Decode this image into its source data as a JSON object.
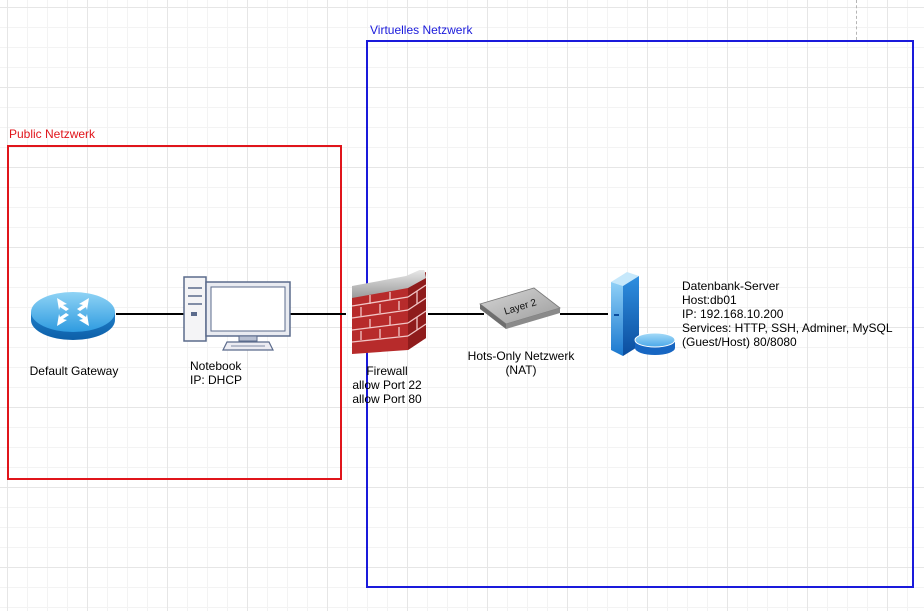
{
  "zones": {
    "public": {
      "label": "Public Netzwerk",
      "color": "#e0151b"
    },
    "virtual": {
      "label": "Virtuelles Netzwerk",
      "color": "#1a1adb"
    }
  },
  "nodes": {
    "gateway": {
      "icon": "router-icon",
      "label": "Default Gateway"
    },
    "notebook": {
      "icon": "desktop-computer-icon",
      "lines": [
        "Notebook",
        "IP: DHCP"
      ]
    },
    "firewall": {
      "icon": "firewall-icon",
      "lines": [
        "Firewall",
        "allow Port 22",
        "allow Port 80"
      ]
    },
    "switch": {
      "icon": "layer2-switch-icon",
      "badge": "Layer 2",
      "lines": [
        "Hots-Only Netzwerk",
        "(NAT)"
      ]
    },
    "server": {
      "icon": "database-server-icon",
      "lines": [
        "Datenbank-Server",
        "Host:db01",
        "IP: 192.168.10.200",
        "Services: HTTP, SSH, Adminer, MySQL",
        "(Guest/Host) 80/8080"
      ]
    }
  }
}
